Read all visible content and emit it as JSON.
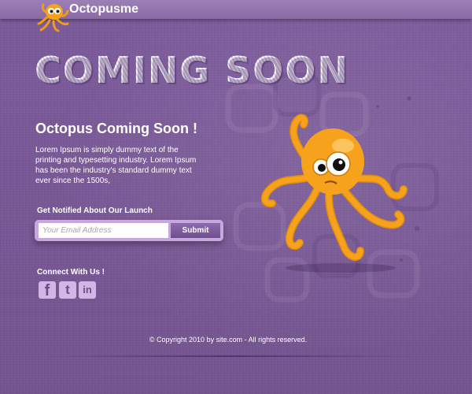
{
  "header": {
    "brand": "Octopusme"
  },
  "hero": {
    "title": "COMING SOON"
  },
  "content": {
    "subtitle": "Octopus Coming Soon !",
    "description": "Lorem Ipsum is simply dummy text of the printing and typesetting industry. Lorem Ipsum has been the industry's standard dummy text ever since the 1500s,"
  },
  "signup": {
    "label": "Get Notified About Our Launch",
    "email_placeholder": "Your Email Address",
    "email_value": "",
    "submit_label": "Submit"
  },
  "social": {
    "label": "Connect With Us !",
    "items": [
      {
        "icon": "facebook-icon",
        "glyph": "f"
      },
      {
        "icon": "twitter-icon",
        "glyph": "t"
      },
      {
        "icon": "linkedin-icon",
        "glyph": "in"
      }
    ]
  },
  "footer": {
    "copyright": "© Copyright 2010 by site.com - All rights reserved."
  },
  "colors": {
    "background": "#7a5a98",
    "header": "#8a6aa6",
    "octopus": "#f6a21c",
    "form_frame": "#c6a8de",
    "button": "#7b5a9a"
  }
}
